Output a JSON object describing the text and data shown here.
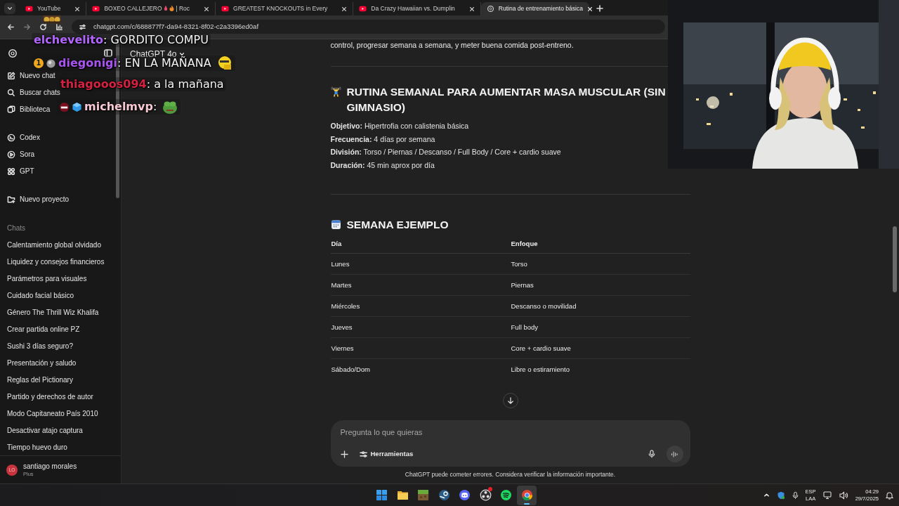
{
  "browser": {
    "tabs": [
      {
        "label": "YouTube",
        "kind": "video",
        "selected": false
      },
      {
        "label": "BOXEO CALLEJERO",
        "label_end": "| Roc",
        "kind": "video",
        "selected": false
      },
      {
        "label": "GREATEST KNOCKOUTS in Every",
        "kind": "video",
        "selected": false
      },
      {
        "label": "Da Crazy Hawaiian vs. Dumplin",
        "kind": "video",
        "selected": false
      },
      {
        "label": "Rutina de entrenamiento básica",
        "kind": "chat",
        "selected": true
      }
    ],
    "url": "chatgpt.com/c/688877f7-da94-8321-8f02-c2a3396ed0af"
  },
  "sidebar": {
    "nav_groups": [
      [
        {
          "label": "Nuevo chat",
          "kind": "compose"
        },
        {
          "label": "Buscar chats",
          "kind": "search"
        },
        {
          "label": "Biblioteca",
          "kind": "library"
        }
      ],
      [
        {
          "label": "Codex",
          "kind": "codex"
        },
        {
          "label": "Sora",
          "kind": "sora"
        },
        {
          "label": "GPT",
          "kind": "gpts"
        }
      ],
      [
        {
          "label": "Nuevo proyecto",
          "kind": "project"
        }
      ]
    ],
    "section_title": "Chats",
    "chats": [
      "Calentamiento global olvidado",
      "Liquidez y consejos financieros",
      "Parámetros para visuales",
      "Cuidado facial básico",
      "Género The Thrill Wiz Khalifa",
      "Crear partida online PZ",
      "Sushi 3 días seguro?",
      "Presentación y saludo",
      "Reglas del Pictionary",
      "Partido y derechos de autor",
      "Modo Capitaneato País 2010",
      "Desactivar atajo captura",
      "Tiempo huevo duro"
    ],
    "user": {
      "initials": "LO",
      "name": "santiago morales",
      "plan": "Plus"
    }
  },
  "header": {
    "model": "ChatGPT 4o"
  },
  "content": {
    "intro": "control, progresar semana a semana, y meter buena comida post-entreno.",
    "sections": [
      {
        "title": "RUTINA SEMANAL PARA AUMENTAR MASA MUSCULAR (SIN GIMNASIO)",
        "lines": [
          "**Objetivo:** Hipertrofia con calistenia básica",
          "**Frecuencia:** 4 días por semana",
          "**División:** Torso / Piernas / Descanso / Full Body / Core + cardio suave",
          "**Duración:** 45 min aprox por día"
        ]
      },
      {
        "title": "SEMANA EJEMPLO",
        "table": {
          "columns": [
            "Día",
            "Enfoque"
          ],
          "rows": [
            [
              "Lunes",
              "Torso"
            ],
            [
              "Martes",
              "Piernas"
            ],
            [
              "Miércoles",
              "Descanso o movilidad"
            ],
            [
              "Jueves",
              "Full body"
            ],
            [
              "Viernes",
              "Core + cardio suave"
            ],
            [
              "Sábado/Dom",
              "Libre o estiramiento"
            ]
          ]
        }
      }
    ]
  },
  "composer": {
    "placeholder": "Pregunta lo que quieras",
    "tools_label": "Herramientas",
    "disclaimer": "ChatGPT puede cometer errores. Considera verificar la información importante."
  },
  "stream_chat": {
    "separator": ":",
    "messages": [
      {
        "kind": "text",
        "user": "elchevelito",
        "color": "#b266ff",
        "text": "GORDITO COMPU"
      },
      {
        "kind": "grin",
        "user": "diegonigi",
        "color": "#a855f0",
        "text": "EN LA MAÑANA",
        "badges": [
          {
            "kind": "count",
            "text": "1"
          },
          {
            "kind": "orb"
          }
        ]
      },
      {
        "kind": "text",
        "user": "thiagooos094",
        "color": "#d4213f",
        "text": "a la mañana"
      },
      {
        "kind": "frog",
        "user": "michelmvp",
        "color": "#f6c9d4",
        "badges": [
          {
            "kind": "mask"
          },
          {
            "kind": "cube"
          }
        ]
      }
    ]
  },
  "taskbar": {
    "apps": [
      {
        "kind": "start",
        "selected": false,
        "notification": false
      },
      {
        "kind": "folder",
        "selected": false,
        "notification": false
      },
      {
        "kind": "block",
        "selected": false,
        "notification": false
      },
      {
        "kind": "steam",
        "selected": false,
        "notification": false
      },
      {
        "kind": "discord",
        "selected": false,
        "notification": false
      },
      {
        "kind": "obs",
        "selected": false,
        "notification": true
      },
      {
        "kind": "spotify",
        "selected": false,
        "notification": false
      },
      {
        "kind": "chrome",
        "selected": true,
        "notification": false
      }
    ],
    "tray": {
      "language": "ESP",
      "layout": "LAA",
      "time": "04:29",
      "date": "29/7/2025"
    }
  }
}
